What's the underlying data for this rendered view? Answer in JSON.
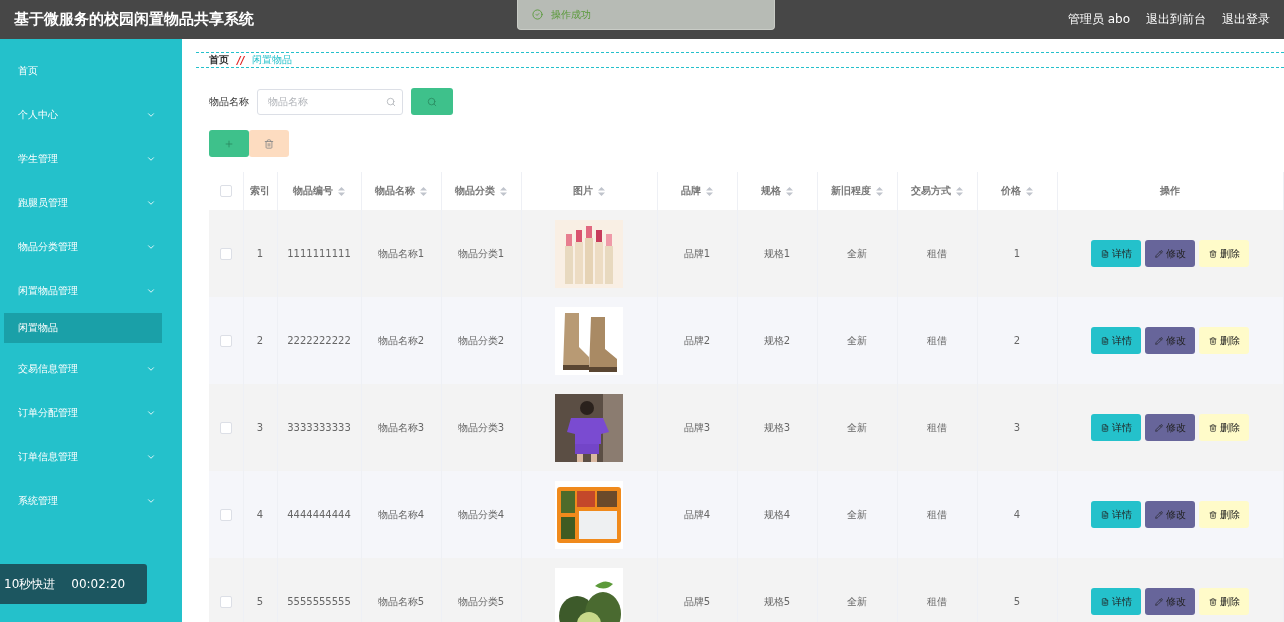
{
  "header": {
    "title": "基于微服务的校园闲置物品共享系统",
    "user": "管理员 abo",
    "links": [
      "退出到前台",
      "退出登录"
    ]
  },
  "toast": {
    "kind": "success",
    "text": "操作成功"
  },
  "sidebar": {
    "items": [
      {
        "label": "首页",
        "expandable": false,
        "selected": false
      },
      {
        "label": "个人中心",
        "expandable": true,
        "selected": false
      },
      {
        "label": "学生管理",
        "expandable": true,
        "selected": false
      },
      {
        "label": "跑腿员管理",
        "expandable": true,
        "selected": false
      },
      {
        "label": "物品分类管理",
        "expandable": true,
        "selected": false
      },
      {
        "label": "闲置物品管理",
        "expandable": true,
        "selected": false,
        "children": [
          {
            "label": "闲置物品",
            "expandable": false,
            "selected": true
          }
        ]
      },
      {
        "label": "交易信息管理",
        "expandable": true,
        "selected": false
      },
      {
        "label": "订单分配管理",
        "expandable": true,
        "selected": false
      },
      {
        "label": "订单信息管理",
        "expandable": true,
        "selected": false
      },
      {
        "label": "系统管理",
        "expandable": true,
        "selected": false
      }
    ]
  },
  "player": {
    "skip": "10秒快进",
    "time": "00:02:20"
  },
  "breadcrumb": {
    "items": [
      "首页",
      "闲置物品"
    ],
    "separator": "//"
  },
  "search": {
    "label": "物品名称",
    "placeholder": "物品名称"
  },
  "table": {
    "select_all_checked": false,
    "columns": [
      {
        "label": "索引",
        "sortable": false
      },
      {
        "label": "物品编号",
        "sortable": true
      },
      {
        "label": "物品名称",
        "sortable": true
      },
      {
        "label": "物品分类",
        "sortable": true
      },
      {
        "label": "图片",
        "sortable": true
      },
      {
        "label": "品牌",
        "sortable": true
      },
      {
        "label": "规格",
        "sortable": true
      },
      {
        "label": "新旧程度",
        "sortable": true
      },
      {
        "label": "交易方式",
        "sortable": true
      },
      {
        "label": "价格",
        "sortable": true
      },
      {
        "label": "操作",
        "sortable": false
      }
    ],
    "rows": [
      {
        "checked": false,
        "cells": [
          "1",
          "1111111111",
          "物品名称1",
          "物品分类1",
          {
            "kind": "picture"
          },
          "品牌1",
          "规格1",
          "全新",
          "租借",
          "1"
        ],
        "actions": [
          {
            "kind": "detail",
            "label": "详情"
          },
          {
            "kind": "edit",
            "label": "修改"
          },
          {
            "kind": "delete",
            "label": "删除"
          }
        ]
      },
      {
        "checked": false,
        "cells": [
          "2",
          "2222222222",
          "物品名称2",
          "物品分类2",
          {
            "kind": "picture"
          },
          "品牌2",
          "规格2",
          "全新",
          "租借",
          "2"
        ],
        "actions": [
          {
            "kind": "detail",
            "label": "详情"
          },
          {
            "kind": "edit",
            "label": "修改"
          },
          {
            "kind": "delete",
            "label": "删除"
          }
        ]
      },
      {
        "checked": false,
        "cells": [
          "3",
          "3333333333",
          "物品名称3",
          "物品分类3",
          {
            "kind": "picture"
          },
          "品牌3",
          "规格3",
          "全新",
          "租借",
          "3"
        ],
        "actions": [
          {
            "kind": "detail",
            "label": "详情"
          },
          {
            "kind": "edit",
            "label": "修改"
          },
          {
            "kind": "delete",
            "label": "删除"
          }
        ]
      },
      {
        "checked": false,
        "cells": [
          "4",
          "4444444444",
          "物品名称4",
          "物品分类4",
          {
            "kind": "picture"
          },
          "品牌4",
          "规格4",
          "全新",
          "租借",
          "4"
        ],
        "actions": [
          {
            "kind": "detail",
            "label": "详情"
          },
          {
            "kind": "edit",
            "label": "修改"
          },
          {
            "kind": "delete",
            "label": "删除"
          }
        ]
      },
      {
        "checked": false,
        "cells": [
          "5",
          "5555555555",
          "物品名称5",
          "物品分类5",
          {
            "kind": "picture"
          },
          "品牌5",
          "规格5",
          "全新",
          "租借",
          "5"
        ],
        "actions": [
          {
            "kind": "detail",
            "label": "详情"
          },
          {
            "kind": "edit",
            "label": "修改"
          },
          {
            "kind": "delete",
            "label": "删除"
          }
        ]
      }
    ]
  }
}
